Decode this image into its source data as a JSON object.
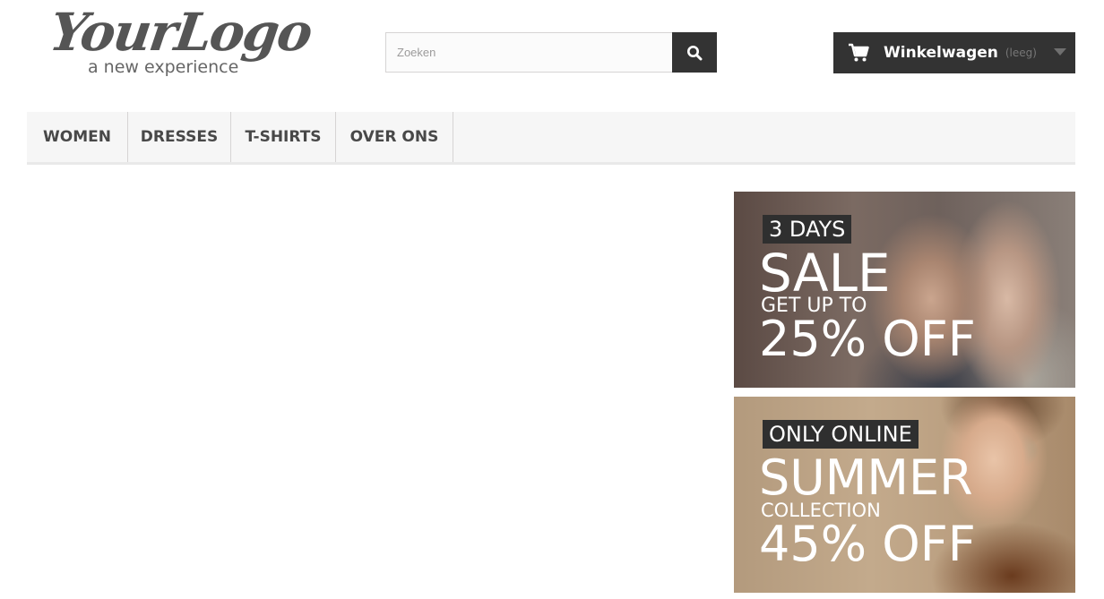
{
  "logo": {
    "script_text": "YourLogo",
    "tagline": "a new experience"
  },
  "search": {
    "placeholder": "Zoeken",
    "button_icon": "search-icon"
  },
  "cart": {
    "label": "Winkelwagen",
    "status": "(leeg)",
    "icon": "cart-icon",
    "dropdown_icon": "chevron-down-icon"
  },
  "menu": {
    "items": [
      {
        "label": "Women"
      },
      {
        "label": "Dresses"
      },
      {
        "label": "T-shirts"
      },
      {
        "label": "Over ons"
      }
    ]
  },
  "banners": [
    {
      "tag": "3 DAYS",
      "headline": "SALE",
      "subline": "GET UP TO",
      "offer": "25% OFF"
    },
    {
      "tag": "ONLY ONLINE",
      "headline": "SUMMER",
      "subline": "COLLECTION",
      "offer": "45% OFF"
    }
  ],
  "colors": {
    "dark": "#333333",
    "menu_bg": "#f6f6f6",
    "menu_text": "#484848"
  }
}
